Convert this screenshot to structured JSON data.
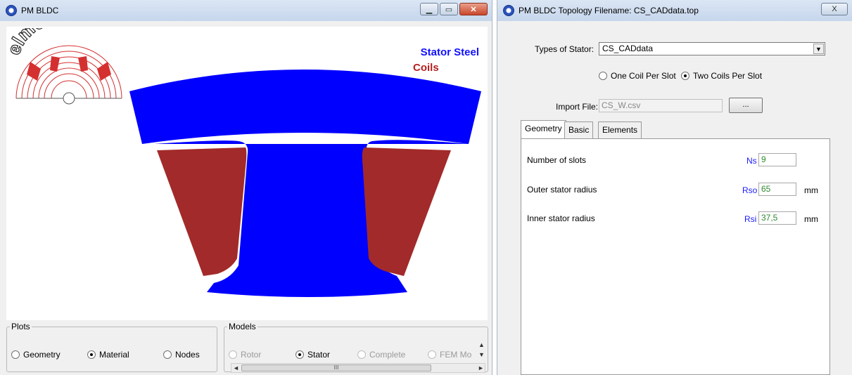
{
  "left_window": {
    "title": "PM BLDC",
    "logo_text": "elmoCAD",
    "legend": {
      "stator_steel": "Stator Steel",
      "coils": "Coils"
    },
    "colors": {
      "stator_steel": "#0000ff",
      "coils": "#a32a2a"
    },
    "plots": {
      "label": "Plots",
      "options": [
        {
          "label": "Geometry",
          "selected": false
        },
        {
          "label": "Material",
          "selected": true
        },
        {
          "label": "Nodes",
          "selected": false
        }
      ]
    },
    "models": {
      "label": "Models",
      "options": [
        {
          "label": "Rotor",
          "selected": false,
          "enabled": false
        },
        {
          "label": "Stator",
          "selected": true,
          "enabled": true
        },
        {
          "label": "Complete",
          "selected": false,
          "enabled": false
        },
        {
          "label": "FEM Mo",
          "selected": false,
          "enabled": false
        }
      ],
      "scroll_thumb": "III"
    }
  },
  "right_window": {
    "title": "PM BLDC  Topology Filename: CS_CADdata.top",
    "close_label": "X",
    "types_of_stator_label": "Types of Stator:",
    "types_of_stator_value": "CS_CADdata",
    "coil_options": [
      {
        "label": "One Coil Per Slot",
        "selected": false
      },
      {
        "label": "Two Coils Per Slot",
        "selected": true
      }
    ],
    "import_file_label": "Import File:",
    "import_file_value": "CS_W.csv",
    "browse_label": "...",
    "tabs": [
      "Geometry",
      "Basic",
      "Elements"
    ],
    "active_tab": "Geometry",
    "params": [
      {
        "label": "Number of slots",
        "symbol": "Ns",
        "value": "9",
        "unit": ""
      },
      {
        "label": "Outer stator radius",
        "symbol": "Rso",
        "value": "65",
        "unit": "mm"
      },
      {
        "label": "Inner stator radius",
        "symbol": "Rsi",
        "value": "37,5",
        "unit": "mm"
      }
    ]
  }
}
